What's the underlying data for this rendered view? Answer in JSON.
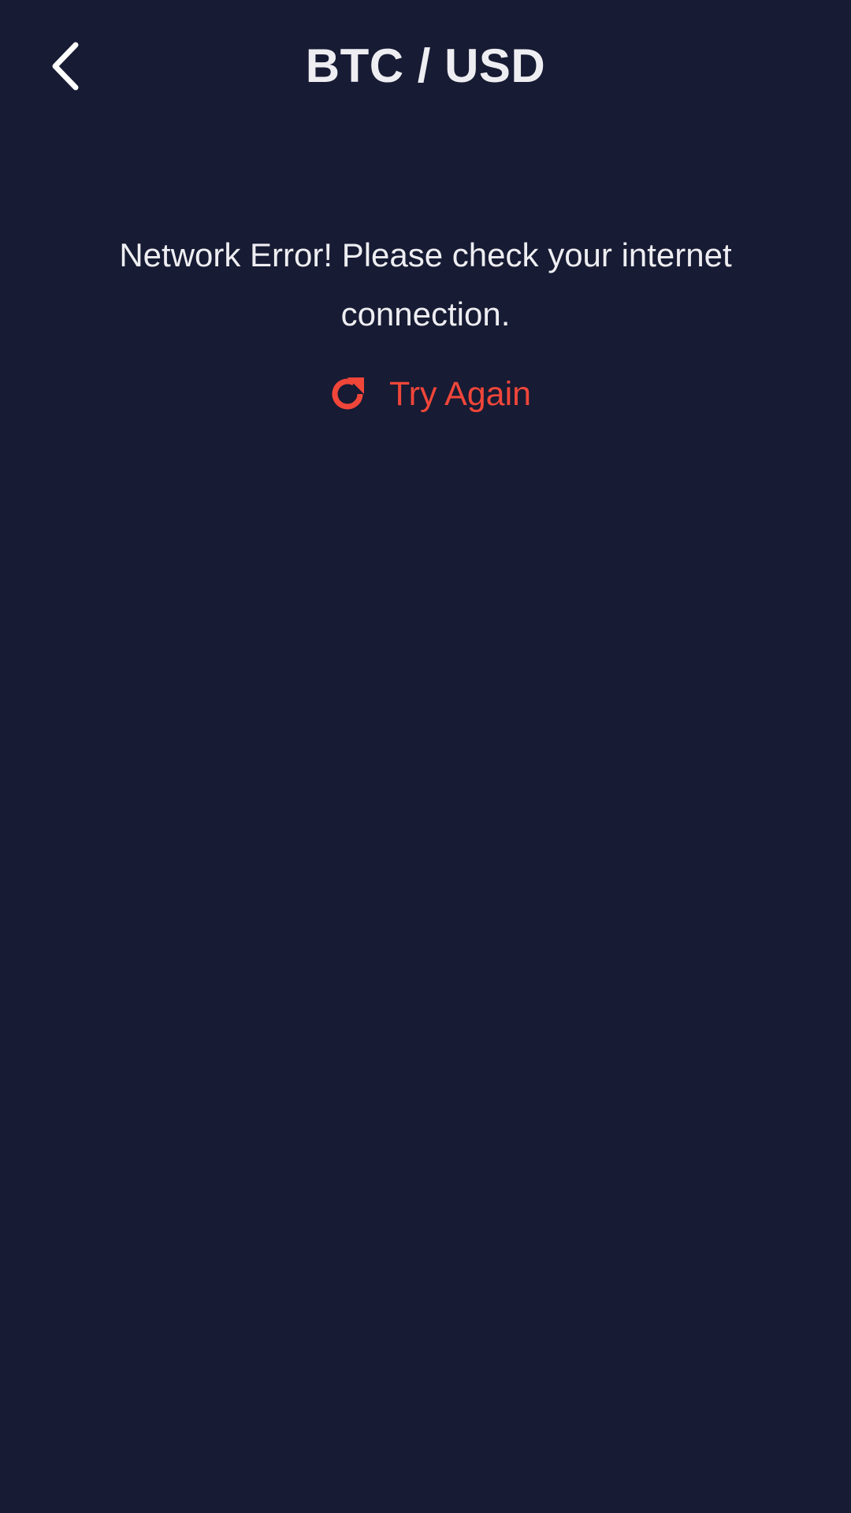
{
  "header": {
    "title": "BTC / USD",
    "back_icon": "chevron-left-icon"
  },
  "error": {
    "message": "Network Error! Please check your internet connection.",
    "retry_label": "Try Again",
    "retry_icon": "refresh-icon"
  },
  "colors": {
    "background": "#171b33",
    "text": "#eeeef2",
    "accent_error": "#f0463a"
  }
}
